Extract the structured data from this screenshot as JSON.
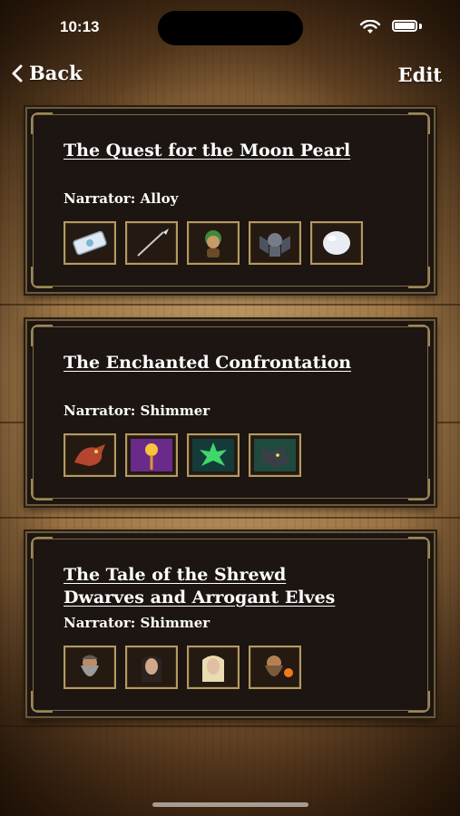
{
  "status_bar": {
    "time": "10:13"
  },
  "nav": {
    "back_label": "Back",
    "edit_label": "Edit"
  },
  "stories": [
    {
      "title": "The Quest for the Moon Pearl",
      "narrator": "Narrator: Alloy",
      "items": [
        "scroll-icon",
        "spear-icon",
        "forest-sprite-icon",
        "gargoyle-icon",
        "moon-pearl-icon"
      ]
    },
    {
      "title": "The Enchanted Confrontation",
      "narrator": "Narrator: Shimmer",
      "items": [
        "dragon-icon",
        "magic-wand-icon",
        "green-leaf-icon",
        "wolf-icon"
      ]
    },
    {
      "title": "The Tale of the Shrewd Dwarves and Arrogant Elves",
      "title_line1": "The Tale of the Shrewd",
      "title_line2": "Dwarves and Arrogant Elves",
      "narrator": "Narrator: Shimmer",
      "items": [
        "dwarf-warrior-icon",
        "elf-dark-hair-icon",
        "elf-blonde-icon",
        "dwarf-smith-icon"
      ]
    }
  ]
}
